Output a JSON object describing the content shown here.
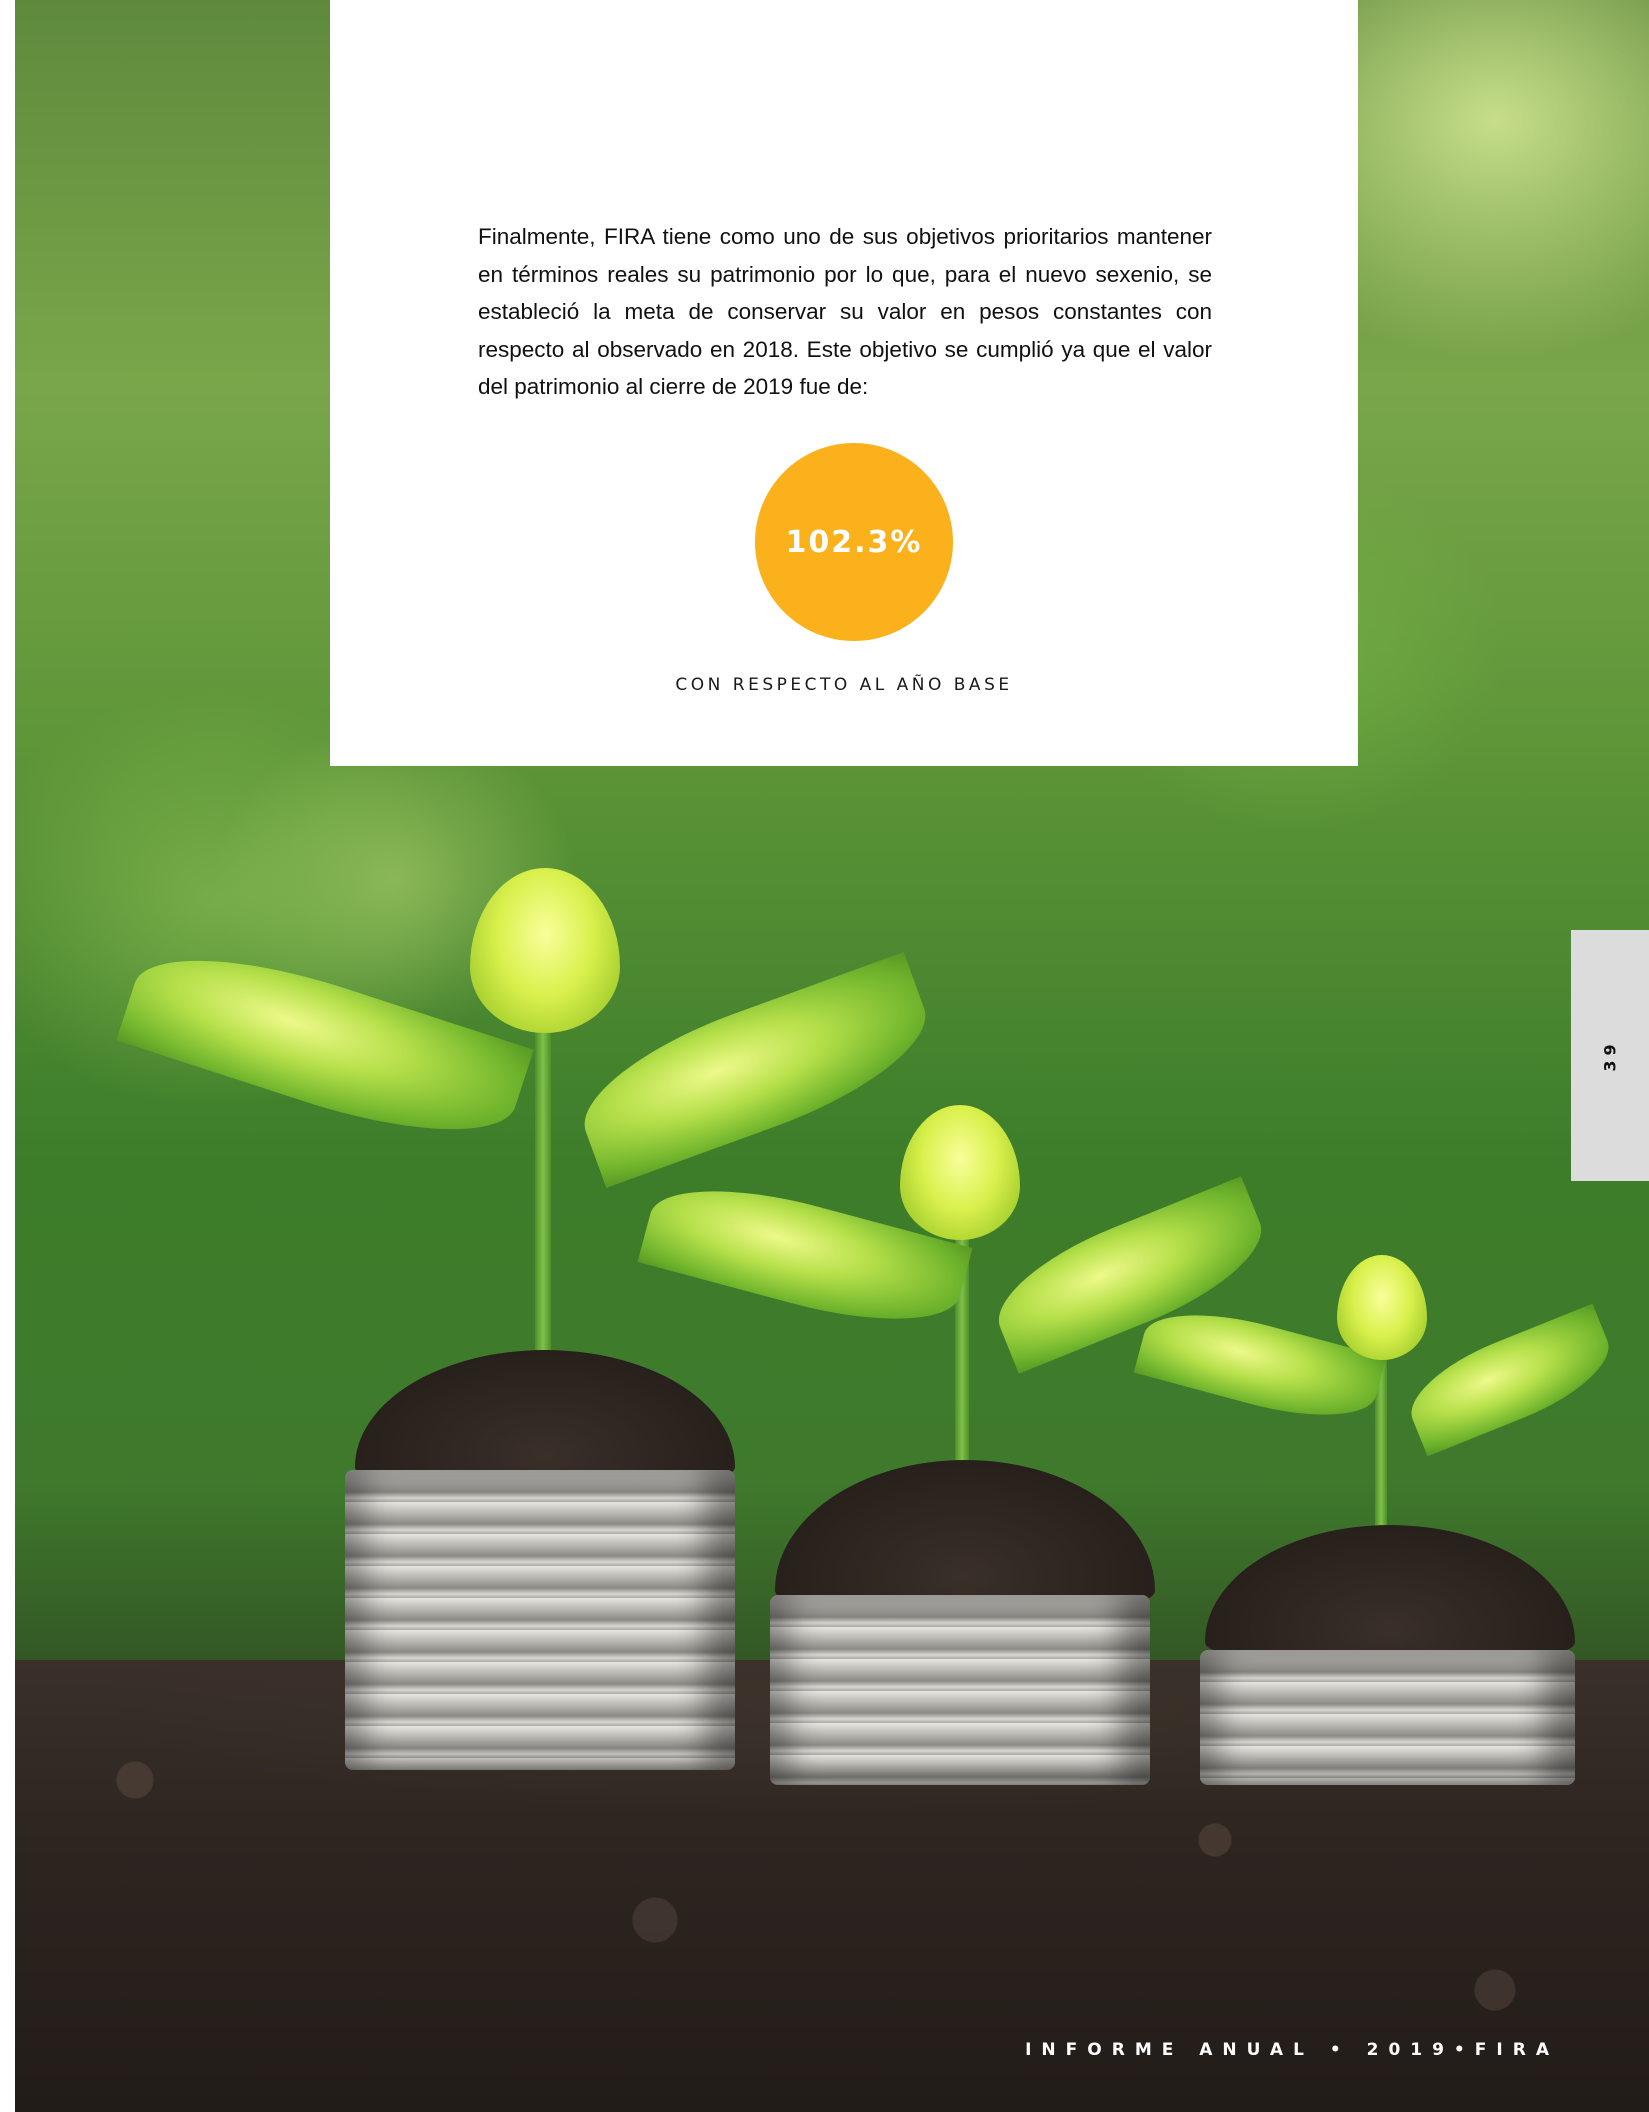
{
  "body": {
    "paragraph": "Finalmente, FIRA tiene como uno de sus objetivos prioritarios mantener en términos reales su patrimonio por lo que, para el nuevo sexenio, se estableció la meta de conservar su valor en pesos constantes con respecto al observado en 2018. Este objetivo se cumplió ya que el valor del patrimonio al cierre de 2019 fue de:"
  },
  "metric": {
    "value": "102.3%",
    "caption": "CON RESPECTO AL AÑO BASE",
    "color": "#fbb11c"
  },
  "side_tab": {
    "page_number": "39"
  },
  "footer": {
    "text": "INFORME ANUAL • 2019•FIRA"
  },
  "background_image": {
    "subject": "plants-growing-on-coin-stacks"
  }
}
